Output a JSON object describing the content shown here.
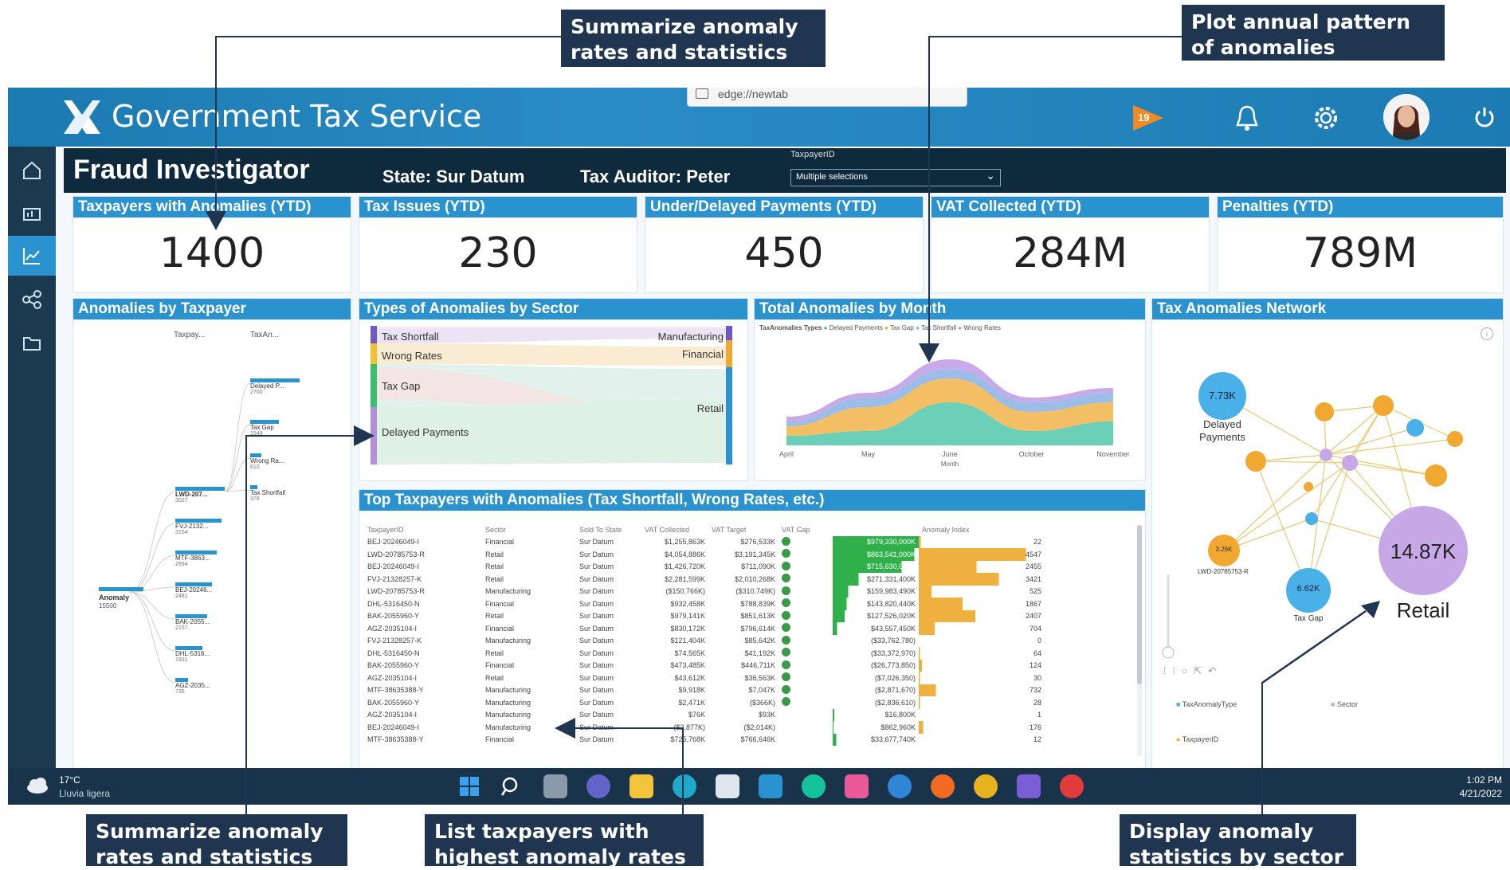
{
  "callouts": {
    "top_left": "Summarize anomaly rates and statistics",
    "top_right": "Plot annual pattern of anomalies",
    "bottom_left": "Summarize anomaly rates and statistics",
    "bottom_mid": "List taxpayers with highest anomaly rates",
    "bottom_right": "Display anomaly statistics by sector"
  },
  "browser": {
    "url_tab": "edge://newtab"
  },
  "app": {
    "title": "Government Tax Service",
    "notification_badge": "19"
  },
  "header": {
    "page_title": "Fraud Investigator",
    "state": "State: Sur Datum",
    "auditor": "Tax Auditor: Peter",
    "filter_label": "TaxpayerID",
    "filter_value": "Multiple selections"
  },
  "kpis": [
    {
      "title": "Taxpayers with Anomalies (YTD)",
      "value": "1400"
    },
    {
      "title": "Tax Issues (YTD)",
      "value": "230"
    },
    {
      "title": "Under/Delayed Payments (YTD)",
      "value": "450"
    },
    {
      "title": "VAT Collected (YTD)",
      "value": "284M"
    },
    {
      "title": "Penalties (YTD)",
      "value": "789M"
    }
  ],
  "panels": {
    "anomalies_by_taxpayer": "Anomalies by Taxpayer",
    "types_by_sector": "Types of Anomalies by Sector",
    "total_by_month": "Total Anomalies by Month",
    "network": "Tax Anomalies Network",
    "top_taxpayers": "Top Taxpayers with Anomalies (Tax Shortfall, Wrong Rates, etc.)"
  },
  "tree": {
    "col1": "Taxpay...",
    "col2": "TaxAn...",
    "root": "Anomaly",
    "root_value": "15500",
    "type_nodes": [
      {
        "label": "Delayed P...",
        "value": "2700"
      },
      {
        "label": "Tax Gap",
        "value": "1549"
      },
      {
        "label": "Wrong Ra...",
        "value": "610"
      },
      {
        "label": "Tax Shortfall",
        "value": "378"
      }
    ],
    "taxpayer_nodes": [
      {
        "label": "LWD-207...",
        "value": "3027"
      },
      {
        "label": "FVJ-2132...",
        "value": "3154"
      },
      {
        "label": "MTF-3863...",
        "value": "2994"
      },
      {
        "label": "BEJ-20246...",
        "value": "2481"
      },
      {
        "label": "BAK-2055...",
        "value": "2157"
      },
      {
        "label": "DHL-5316...",
        "value": "1931"
      },
      {
        "label": "AGZ-2035...",
        "value": "735"
      }
    ]
  },
  "sankey": {
    "left": [
      "Tax Shortfall",
      "Wrong Rates",
      "Tax Gap",
      "Delayed Payments"
    ],
    "right": [
      "Manufacturing",
      "Financial",
      "Retail"
    ]
  },
  "chart_data": {
    "type": "area",
    "title": "Total Anomalies by Month",
    "legend_title": "TaxAnomalies Types",
    "legend": [
      "Delayed Payments",
      "Tax Gap",
      "Tax Shortfall",
      "Wrong Rates"
    ],
    "xlabel": "Month",
    "categories": [
      "April",
      "May",
      "June",
      "October",
      "November"
    ],
    "series": [
      {
        "name": "Delayed Payments",
        "color": "#3bbf9f",
        "values": [
          2,
          3,
          9,
          3,
          5
        ]
      },
      {
        "name": "Tax Gap",
        "color": "#f0a830",
        "values": [
          2,
          5,
          5,
          4,
          4
        ]
      },
      {
        "name": "Tax Shortfall",
        "color": "#7aa7e0",
        "values": [
          1,
          2,
          2,
          2,
          2
        ]
      },
      {
        "name": "Wrong Rates",
        "color": "#b58ee0",
        "values": [
          1,
          1,
          2,
          1,
          1
        ]
      }
    ]
  },
  "network": {
    "nodes": [
      {
        "label": "7.73K",
        "caption": "Delayed Payments"
      },
      {
        "label": "14.87K",
        "caption": "Retail"
      },
      {
        "label": "6.62K",
        "caption": "Tax Gap"
      },
      {
        "label": "3.26K",
        "caption": "LWD-20785753-R"
      }
    ],
    "legend": [
      "TaxAnomalyType",
      "Sector",
      "TaxpayerID"
    ]
  },
  "table": {
    "columns": [
      "TaxpayerID",
      "Sector",
      "Sold To State",
      "VAT Collected",
      "VAT Target",
      "VAT Gap",
      "",
      "Anomaly Index"
    ],
    "rows": [
      [
        "BEJ-20246049-I",
        "Financial",
        "Sur Datum",
        "$1,255,863K",
        "$276,533K",
        "",
        "$979,330,000K",
        "22"
      ],
      [
        "LWD-20785753-R",
        "Retail",
        "Sur Datum",
        "$4,054,886K",
        "$3,191,345K",
        "",
        "$863,541,000K",
        "4547"
      ],
      [
        "BEJ-20246049-I",
        "Retail",
        "Sur Datum",
        "$1,426,720K",
        "$711,090K",
        "",
        "$715,630,000K",
        "2455"
      ],
      [
        "FVJ-21328257-K",
        "Retail",
        "Sur Datum",
        "$2,281,599K",
        "$2,010,268K",
        "",
        "$271,331,400K",
        "3421"
      ],
      [
        "LWD-20785753-R",
        "Manufacturing",
        "Sur Datum",
        "($150,766K)",
        "($310,749K)",
        "",
        "$159,983,490K",
        "525"
      ],
      [
        "DHL-5316450-N",
        "Financial",
        "Sur Datum",
        "$932,458K",
        "$788,839K",
        "",
        "$143,820,440K",
        "1867"
      ],
      [
        "BAK-2055960-Y",
        "Retail",
        "Sur Datum",
        "$979,141K",
        "$851,613K",
        "",
        "$127,526,020K",
        "2407"
      ],
      [
        "AGZ-2035104-I",
        "Financial",
        "Sur Datum",
        "$830,172K",
        "$796,614K",
        "",
        "$43,557,450K",
        "704"
      ],
      [
        "FVJ-21328257-K",
        "Manufacturing",
        "Sur Datum",
        "$121,404K",
        "$85,642K",
        "",
        "($33,762,780)",
        "0"
      ],
      [
        "DHL-5316450-N",
        "Retail",
        "Sur Datum",
        "$74,565K",
        "$41,192K",
        "",
        "($33,372,970)",
        "64"
      ],
      [
        "BAK-2055960-Y",
        "Financial",
        "Sur Datum",
        "$473,485K",
        "$446,711K",
        "",
        "($26,773,850)",
        "124"
      ],
      [
        "AGZ-2035104-I",
        "Retail",
        "Sur Datum",
        "$43,612K",
        "$36,563K",
        "",
        "($7,026,350)",
        "30"
      ],
      [
        "MTF-38635388-Y",
        "Manufacturing",
        "Sur Datum",
        "$9,918K",
        "$7,047K",
        "",
        "($2,871,670)",
        "732"
      ],
      [
        "BAK-2055960-Y",
        "Manufacturing",
        "Sur Datum",
        "$2,471K",
        "($366K)",
        "",
        "($2,836,610)",
        "28"
      ],
      [
        "AGZ-2035104-I",
        "Manufacturing",
        "Sur Datum",
        "$76K",
        "$93K",
        "",
        "$16,800K",
        "1"
      ],
      [
        "BEJ-20246049-I",
        "Manufacturing",
        "Sur Datum",
        "($2,877K)",
        "($2,014K)",
        "",
        "$862,960K",
        "176"
      ],
      [
        "MTF-38635388-Y",
        "Financial",
        "Sur Datum",
        "$725,768K",
        "$766,646K",
        "",
        "$33,677,740K",
        "12"
      ]
    ],
    "gap_fill": [
      1,
      0.95,
      0.8,
      0.3,
      0.18,
      0.16,
      0.14,
      0.05,
      0,
      0,
      0,
      0,
      0,
      0,
      0.02,
      0.01,
      0.04
    ],
    "index_fill": [
      0.02,
      1,
      0.54,
      0.75,
      0.12,
      0.41,
      0.53,
      0.15,
      0,
      0.01,
      0.03,
      0.01,
      0.16,
      0.01,
      0,
      0.04,
      0
    ]
  },
  "taskbar": {
    "temperature": "17°C",
    "weather": "Lluvia ligera",
    "time": "1:02 PM",
    "date": "4/21/2022"
  }
}
